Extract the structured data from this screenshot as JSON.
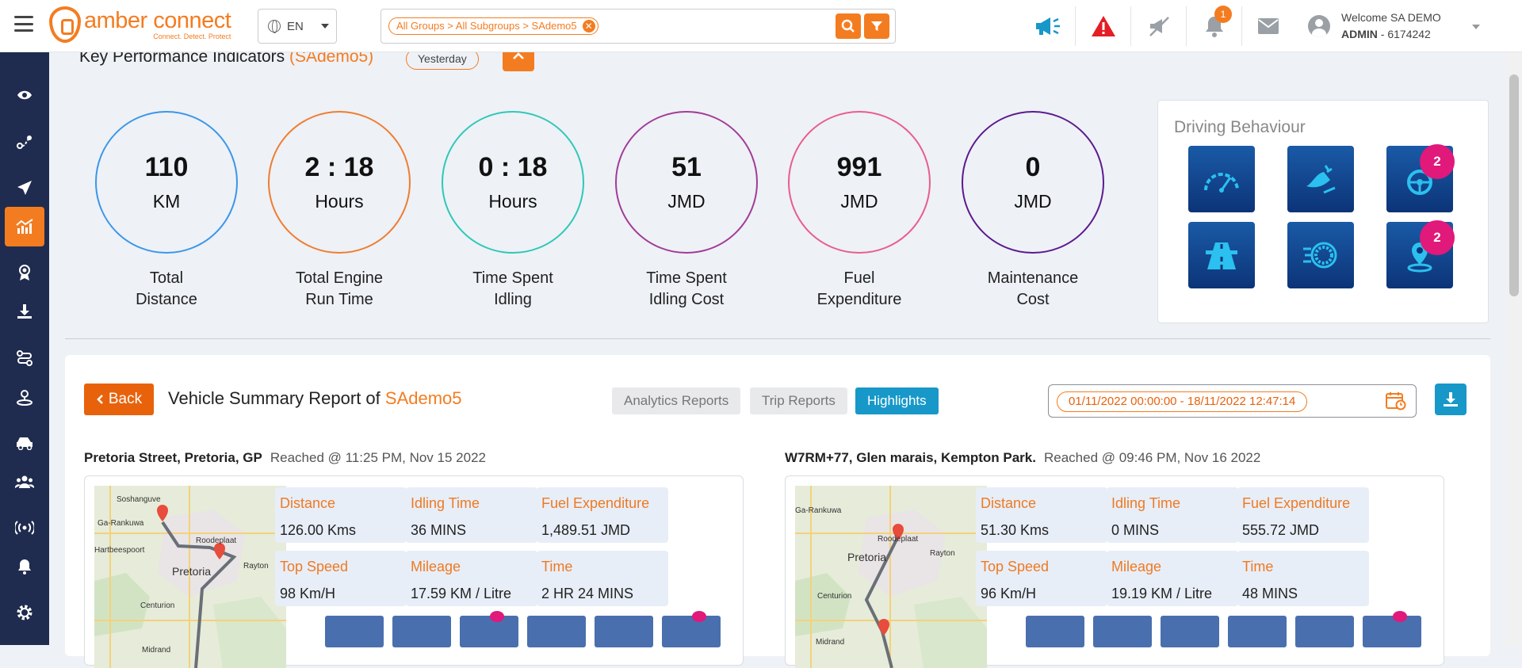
{
  "header": {
    "brand_name": "amber connect",
    "brand_tagline": "Connect. Detect. Protect",
    "language": "EN",
    "breadcrumb": "All Groups > All Subgroups > SAdemo5",
    "notification_count": "1",
    "welcome": "Welcome SA DEMO",
    "role": "ADMIN",
    "account_id": " - 6174242"
  },
  "sidebar": {
    "items": [
      "eye-icon",
      "route-icon",
      "send-icon",
      "analytics-icon",
      "award-icon",
      "download-icon",
      "trips-icon",
      "location-person-icon",
      "vehicle-icon",
      "users-icon",
      "broadcast-icon",
      "bell-icon",
      "settings-icon"
    ],
    "active": "analytics-icon"
  },
  "kpi": {
    "title": "Key Performance Indicators",
    "org": "(SAdemo5)",
    "period": "Yesterday",
    "items": [
      {
        "value": "110",
        "unit": "KM",
        "label1": "Total",
        "label2": "Distance",
        "color": "#3a96ea"
      },
      {
        "value": "2 : 18",
        "unit": "Hours",
        "label1": "Total Engine",
        "label2": "Run Time",
        "color": "#ef7d31"
      },
      {
        "value": "0 : 18",
        "unit": "Hours",
        "label1": "Time Spent",
        "label2": "Idling",
        "color": "#2ec8b8"
      },
      {
        "value": "51",
        "unit": "JMD",
        "label1": "Time Spent",
        "label2": "Idling Cost",
        "color": "#a23b98"
      },
      {
        "value": "991",
        "unit": "JMD",
        "label1": "Fuel",
        "label2": "Expenditure",
        "color": "#e85d8c"
      },
      {
        "value": "0",
        "unit": "JMD",
        "label1": "Maintenance",
        "label2": "Cost",
        "color": "#5b1a8f"
      }
    ]
  },
  "driving_behaviour": {
    "title": "Driving Behaviour",
    "tiles": [
      {
        "icon": "speedometer-icon",
        "badge": ""
      },
      {
        "icon": "harsh-braking-icon",
        "badge": ""
      },
      {
        "icon": "steering-wheel-icon",
        "badge": "2"
      },
      {
        "icon": "highway-icon",
        "badge": ""
      },
      {
        "icon": "acceleration-icon",
        "badge": ""
      },
      {
        "icon": "location-pin-icon",
        "badge": "2"
      }
    ]
  },
  "report": {
    "back_label": "Back",
    "title": "Vehicle Summary Report of ",
    "vehicle": "SAdemo5",
    "tabs": [
      "Analytics Reports",
      "Trip Reports",
      "Highlights"
    ],
    "active_tab": "Highlights",
    "date_range": "01/11/2022 00:00:00 - 18/11/2022 12:47:14"
  },
  "trips": [
    {
      "location": "Pretoria Street, Pretoria, GP",
      "reached": "Reached @ 11:25 PM, Nov 15 2022",
      "map_labels": [
        "Soshanguve",
        "Ga-Rankuwa",
        "Hartbeespoort",
        "Pretoria",
        "Rayton",
        "Centurion",
        "Midrand",
        "Roodeplaat"
      ],
      "stats": [
        {
          "label": "Distance",
          "value": "126.00 Kms"
        },
        {
          "label": "Idling Time",
          "value": "36 MINS"
        },
        {
          "label": "Fuel Expenditure",
          "value": "1,489.51 JMD"
        },
        {
          "label": "Top Speed",
          "value": "98 Km/H"
        },
        {
          "label": "Mileage",
          "value": "17.59 KM / Litre"
        },
        {
          "label": "Time",
          "value": "2 HR 24 MINS"
        }
      ]
    },
    {
      "location": "W7RM+77, Glen marais, Kempton Park.",
      "reached": "Reached @ 09:46 PM, Nov 16 2022",
      "map_labels": [
        "Ga-Rankuwa",
        "Pretoria",
        "Rayton",
        "Centurion",
        "Midrand",
        "Roodeplaat"
      ],
      "stats": [
        {
          "label": "Distance",
          "value": "51.30 Kms"
        },
        {
          "label": "Idling Time",
          "value": "0 MINS"
        },
        {
          "label": "Fuel Expenditure",
          "value": "555.72 JMD"
        },
        {
          "label": "Top Speed",
          "value": "96 Km/H"
        },
        {
          "label": "Mileage",
          "value": "19.19 KM / Litre"
        },
        {
          "label": "Time",
          "value": "48 MINS"
        }
      ]
    }
  ]
}
